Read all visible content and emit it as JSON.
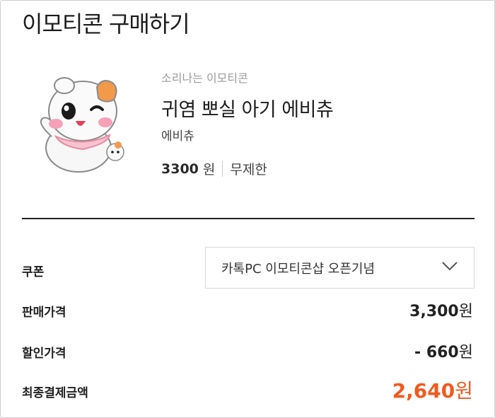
{
  "header": {
    "title": "이모티콘 구매하기"
  },
  "product": {
    "category": "소리나는 이모티콘",
    "name": "귀염 뽀실 아기 에비츄",
    "author": "에비츄",
    "price": "3300",
    "price_unit": "원",
    "term": "무제한",
    "thumbnail_icon": "hamster-character-icon"
  },
  "coupon": {
    "label": "쿠폰",
    "selected": "카톡PC 이모티콘샵 오픈기념"
  },
  "summary": {
    "sale_label": "판매가격",
    "sale_value": "3,300",
    "discount_label": "할인가격",
    "discount_value": "- 660",
    "final_label": "최종결제금액",
    "final_value": "2,640",
    "unit": "원"
  },
  "colors": {
    "accent": "#f25a1e",
    "divider": "#222222"
  }
}
